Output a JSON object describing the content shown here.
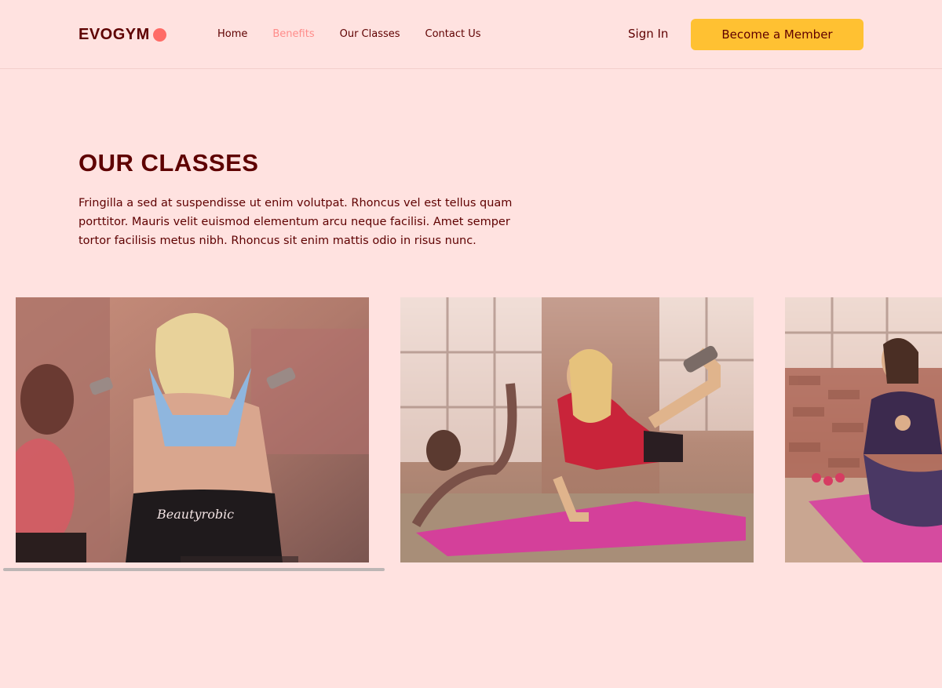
{
  "nav": {
    "logo_text": "EVOGYM",
    "links": [
      {
        "label": "Home",
        "active": false
      },
      {
        "label": "Benefits",
        "active": true
      },
      {
        "label": "Our Classes",
        "active": false
      },
      {
        "label": "Contact Us",
        "active": false
      }
    ],
    "sign_in": "Sign In",
    "cta": "Become a Member"
  },
  "section": {
    "title": "OUR CLASSES",
    "description": "Fringilla a sed at suspendisse ut enim volutpat. Rhoncus vel est tellus quam porttitor. Mauris velit euismod elementum arcu neque facilisi. Amet semper tortor facilisis metus nibh. Rhoncus sit enim mattis odio in risus nunc."
  },
  "cards": [
    {
      "image": "woman-lifting-dumbbells-photo"
    },
    {
      "image": "women-exercising-on-mats-photo"
    },
    {
      "image": "woman-stretching-on-mat-photo"
    }
  ],
  "colors": {
    "background": "#ffe2e0",
    "primary_text": "#5e0000",
    "accent": "#ff6b66",
    "button": "#ffc132",
    "active_link": "#ff8c8a"
  }
}
